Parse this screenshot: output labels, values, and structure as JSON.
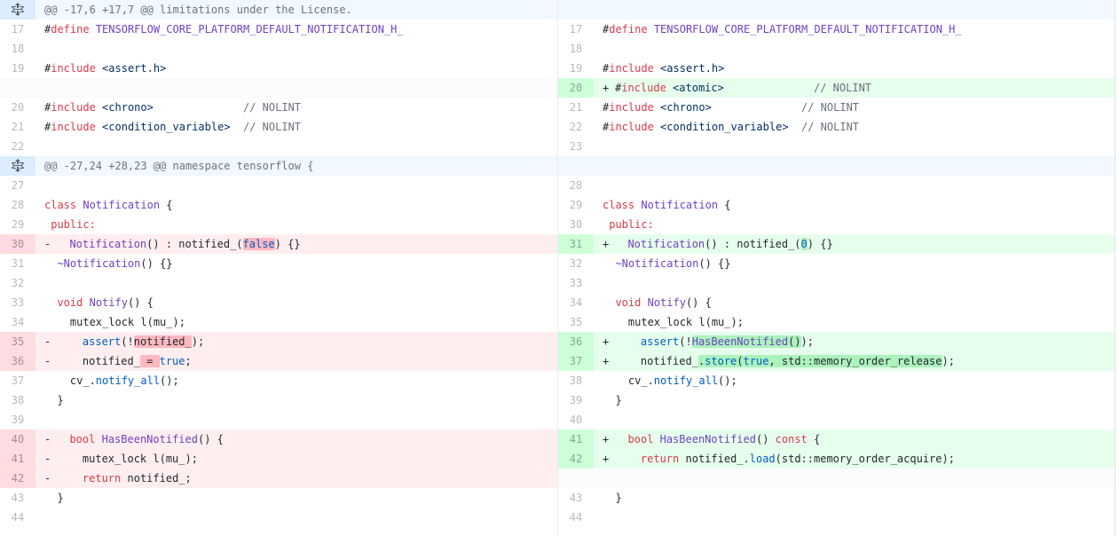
{
  "hunks": [
    {
      "header": "@@ -17,6 +17,7 @@ limitations under the License."
    },
    {
      "header": "@@ -27,24 +28,23 @@ namespace tensorflow {"
    }
  ],
  "rows": [
    {
      "type": "hunk",
      "hunk": 0
    },
    {
      "type": "line",
      "left": {
        "num": "17",
        "kind": "ctx",
        "parts": [
          [
            "",
            "#"
          ],
          [
            "k",
            "define"
          ],
          [
            "",
            " "
          ],
          [
            "f",
            "TENSORFLOW_CORE_PLATFORM_DEFAULT_NOTIFICATION_H_"
          ]
        ]
      },
      "right": {
        "num": "17",
        "kind": "ctx",
        "parts": [
          [
            "",
            "#"
          ],
          [
            "k",
            "define"
          ],
          [
            "",
            " "
          ],
          [
            "f",
            "TENSORFLOW_CORE_PLATFORM_DEFAULT_NOTIFICATION_H_"
          ]
        ]
      }
    },
    {
      "type": "line",
      "left": {
        "num": "18",
        "kind": "ctx",
        "parts": []
      },
      "right": {
        "num": "18",
        "kind": "ctx",
        "parts": []
      }
    },
    {
      "type": "line",
      "left": {
        "num": "19",
        "kind": "ctx",
        "parts": [
          [
            "",
            "#"
          ],
          [
            "k",
            "include"
          ],
          [
            "",
            " "
          ],
          [
            "s",
            "<assert.h>"
          ]
        ]
      },
      "right": {
        "num": "19",
        "kind": "ctx",
        "parts": [
          [
            "",
            "#"
          ],
          [
            "k",
            "include"
          ],
          [
            "",
            " "
          ],
          [
            "s",
            "<assert.h>"
          ]
        ]
      }
    },
    {
      "type": "line",
      "left": {
        "num": "",
        "kind": "empty",
        "parts": []
      },
      "right": {
        "num": "20",
        "kind": "add",
        "sign": "+",
        "parts": [
          [
            "",
            "#"
          ],
          [
            "k",
            "include"
          ],
          [
            "",
            " "
          ],
          [
            "s",
            "<atomic>"
          ],
          [
            "",
            "              "
          ],
          [
            "c",
            "// NOLINT"
          ]
        ]
      }
    },
    {
      "type": "line",
      "left": {
        "num": "20",
        "kind": "ctx",
        "parts": [
          [
            "",
            "#"
          ],
          [
            "k",
            "include"
          ],
          [
            "",
            " "
          ],
          [
            "s",
            "<chrono>"
          ],
          [
            "",
            "              "
          ],
          [
            "c",
            "// NOLINT"
          ]
        ]
      },
      "right": {
        "num": "21",
        "kind": "ctx",
        "parts": [
          [
            "",
            "#"
          ],
          [
            "k",
            "include"
          ],
          [
            "",
            " "
          ],
          [
            "s",
            "<chrono>"
          ],
          [
            "",
            "              "
          ],
          [
            "c",
            "// NOLINT"
          ]
        ]
      }
    },
    {
      "type": "line",
      "left": {
        "num": "21",
        "kind": "ctx",
        "parts": [
          [
            "",
            "#"
          ],
          [
            "k",
            "include"
          ],
          [
            "",
            " "
          ],
          [
            "s",
            "<condition_variable>"
          ],
          [
            "",
            "  "
          ],
          [
            "c",
            "// NOLINT"
          ]
        ]
      },
      "right": {
        "num": "22",
        "kind": "ctx",
        "parts": [
          [
            "",
            "#"
          ],
          [
            "k",
            "include"
          ],
          [
            "",
            " "
          ],
          [
            "s",
            "<condition_variable>"
          ],
          [
            "",
            "  "
          ],
          [
            "c",
            "// NOLINT"
          ]
        ]
      }
    },
    {
      "type": "line",
      "left": {
        "num": "22",
        "kind": "ctx",
        "parts": []
      },
      "right": {
        "num": "23",
        "kind": "ctx",
        "parts": []
      }
    },
    {
      "type": "hunk",
      "hunk": 1
    },
    {
      "type": "line",
      "left": {
        "num": "27",
        "kind": "ctx",
        "parts": []
      },
      "right": {
        "num": "28",
        "kind": "ctx",
        "parts": []
      }
    },
    {
      "type": "line",
      "left": {
        "num": "28",
        "kind": "ctx",
        "parts": [
          [
            "k",
            "class"
          ],
          [
            "",
            " "
          ],
          [
            "f",
            "Notification"
          ],
          [
            "",
            " {"
          ]
        ]
      },
      "right": {
        "num": "29",
        "kind": "ctx",
        "parts": [
          [
            "k",
            "class"
          ],
          [
            "",
            " "
          ],
          [
            "f",
            "Notification"
          ],
          [
            "",
            " {"
          ]
        ]
      }
    },
    {
      "type": "line",
      "left": {
        "num": "29",
        "kind": "ctx",
        "parts": [
          [
            "k",
            " public:"
          ]
        ]
      },
      "right": {
        "num": "30",
        "kind": "ctx",
        "parts": [
          [
            "k",
            " public:"
          ]
        ]
      }
    },
    {
      "type": "line",
      "left": {
        "num": "30",
        "kind": "del",
        "sign": "-",
        "parts": [
          [
            "",
            "  "
          ],
          [
            "f",
            "Notification"
          ],
          [
            "",
            "() : notified_("
          ],
          [
            "n xd",
            "false"
          ],
          [
            "",
            ") {}"
          ]
        ]
      },
      "right": {
        "num": "31",
        "kind": "add",
        "sign": "+",
        "parts": [
          [
            "",
            "  "
          ],
          [
            "f",
            "Notification"
          ],
          [
            "",
            "() : notified_("
          ],
          [
            "n xa",
            "0"
          ],
          [
            "",
            ") {}"
          ]
        ]
      }
    },
    {
      "type": "line",
      "left": {
        "num": "31",
        "kind": "ctx",
        "parts": [
          [
            "",
            "  "
          ],
          [
            "f",
            "~Notification"
          ],
          [
            "",
            "() {}"
          ]
        ]
      },
      "right": {
        "num": "32",
        "kind": "ctx",
        "parts": [
          [
            "",
            "  "
          ],
          [
            "f",
            "~Notification"
          ],
          [
            "",
            "() {}"
          ]
        ]
      }
    },
    {
      "type": "line",
      "left": {
        "num": "32",
        "kind": "ctx",
        "parts": []
      },
      "right": {
        "num": "33",
        "kind": "ctx",
        "parts": []
      }
    },
    {
      "type": "line",
      "left": {
        "num": "33",
        "kind": "ctx",
        "parts": [
          [
            "",
            "  "
          ],
          [
            "k",
            "void"
          ],
          [
            "",
            " "
          ],
          [
            "f",
            "Notify"
          ],
          [
            "",
            "() {"
          ]
        ]
      },
      "right": {
        "num": "34",
        "kind": "ctx",
        "parts": [
          [
            "",
            "  "
          ],
          [
            "k",
            "void"
          ],
          [
            "",
            " "
          ],
          [
            "f",
            "Notify"
          ],
          [
            "",
            "() {"
          ]
        ]
      }
    },
    {
      "type": "line",
      "left": {
        "num": "34",
        "kind": "ctx",
        "parts": [
          [
            "",
            "    mutex_lock l(mu_);"
          ]
        ]
      },
      "right": {
        "num": "35",
        "kind": "ctx",
        "parts": [
          [
            "",
            "    mutex_lock l(mu_);"
          ]
        ]
      }
    },
    {
      "type": "line",
      "left": {
        "num": "35",
        "kind": "del",
        "sign": "-",
        "parts": [
          [
            "",
            "    "
          ],
          [
            "n",
            "assert"
          ],
          [
            "",
            "(!"
          ],
          [
            "xd",
            "notified_"
          ],
          [
            "",
            ");"
          ]
        ]
      },
      "right": {
        "num": "36",
        "kind": "add",
        "sign": "+",
        "parts": [
          [
            "",
            "    "
          ],
          [
            "n",
            "assert"
          ],
          [
            "",
            "(!"
          ],
          [
            "f xa",
            "HasBeenNotified"
          ],
          [
            "xa",
            "()"
          ],
          [
            "",
            ");"
          ]
        ]
      }
    },
    {
      "type": "line",
      "left": {
        "num": "36",
        "kind": "del",
        "sign": "-",
        "parts": [
          [
            "",
            "    notified_"
          ],
          [
            "xd",
            " = "
          ],
          [
            "n",
            "true"
          ],
          [
            "",
            ";"
          ]
        ]
      },
      "right": {
        "num": "37",
        "kind": "add",
        "sign": "+",
        "parts": [
          [
            "",
            "    notified_"
          ],
          [
            "xa",
            "."
          ],
          [
            "n xa",
            "store"
          ],
          [
            "xa",
            "("
          ],
          [
            "n xa",
            "true"
          ],
          [
            "xa",
            ", std::memory_order_release"
          ],
          [
            "",
            ");"
          ]
        ]
      }
    },
    {
      "type": "line",
      "left": {
        "num": "37",
        "kind": "ctx",
        "parts": [
          [
            "",
            "    cv_."
          ],
          [
            "n",
            "notify_all"
          ],
          [
            "",
            "();"
          ]
        ]
      },
      "right": {
        "num": "38",
        "kind": "ctx",
        "parts": [
          [
            "",
            "    cv_."
          ],
          [
            "n",
            "notify_all"
          ],
          [
            "",
            "();"
          ]
        ]
      }
    },
    {
      "type": "line",
      "left": {
        "num": "38",
        "kind": "ctx",
        "parts": [
          [
            "",
            "  }"
          ]
        ]
      },
      "right": {
        "num": "39",
        "kind": "ctx",
        "parts": [
          [
            "",
            "  }"
          ]
        ]
      }
    },
    {
      "type": "line",
      "left": {
        "num": "39",
        "kind": "ctx",
        "parts": []
      },
      "right": {
        "num": "40",
        "kind": "ctx",
        "parts": []
      }
    },
    {
      "type": "line",
      "left": {
        "num": "40",
        "kind": "del",
        "sign": "-",
        "parts": [
          [
            "",
            "  "
          ],
          [
            "k",
            "bool"
          ],
          [
            "",
            " "
          ],
          [
            "f",
            "HasBeenNotified"
          ],
          [
            "",
            "() {"
          ]
        ]
      },
      "right": {
        "num": "41",
        "kind": "add",
        "sign": "+",
        "parts": [
          [
            "",
            "  "
          ],
          [
            "k",
            "bool"
          ],
          [
            "",
            " "
          ],
          [
            "f",
            "HasBeenNotified"
          ],
          [
            "",
            "() "
          ],
          [
            "k",
            "const"
          ],
          [
            "",
            " {"
          ]
        ]
      }
    },
    {
      "type": "line",
      "left": {
        "num": "41",
        "kind": "del",
        "sign": "-",
        "parts": [
          [
            "",
            "    mutex_lock l(mu_);"
          ]
        ]
      },
      "right": {
        "num": "42",
        "kind": "add",
        "sign": "+",
        "parts": [
          [
            "",
            "    "
          ],
          [
            "k",
            "return"
          ],
          [
            "",
            " notified_."
          ],
          [
            "n",
            "load"
          ],
          [
            "",
            "(std::memory_order_acquire);"
          ]
        ]
      }
    },
    {
      "type": "line",
      "left": {
        "num": "42",
        "kind": "del",
        "sign": "-",
        "parts": [
          [
            "",
            "    "
          ],
          [
            "k",
            "return"
          ],
          [
            "",
            " notified_;"
          ]
        ]
      },
      "right": {
        "num": "",
        "kind": "empty",
        "parts": []
      }
    },
    {
      "type": "line",
      "left": {
        "num": "43",
        "kind": "ctx",
        "parts": [
          [
            "",
            "  }"
          ]
        ]
      },
      "right": {
        "num": "43",
        "kind": "ctx",
        "parts": [
          [
            "",
            "  }"
          ]
        ]
      }
    },
    {
      "type": "line",
      "left": {
        "num": "44",
        "kind": "ctx",
        "parts": []
      },
      "right": {
        "num": "44",
        "kind": "ctx",
        "parts": []
      }
    }
  ]
}
